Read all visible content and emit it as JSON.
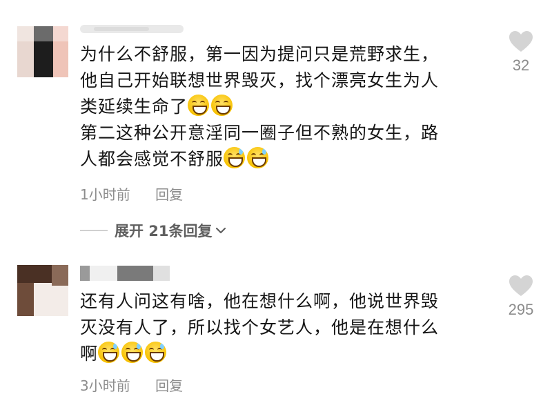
{
  "comments": [
    {
      "lines": [
        "为什么不舒服，第一因为提问只是荒野求生，",
        "他自己开始联想世界毁灭，找个漂亮女生为人",
        "类延续生命了",
        "第二这种公开意淫同一圈子但不熟的女生，路",
        "人都会感觉不舒服"
      ],
      "time": "1小时前",
      "reply_label": "回复",
      "likes": "32"
    },
    {
      "lines": [
        "还有人问这有啥，他在想什么啊，他说世界毁",
        "灭没有人了，所以找个女艺人，他是在想什么",
        "啊"
      ],
      "time": "3小时前",
      "reply_label": "回复",
      "likes": "295"
    }
  ],
  "expand_replies_label": "展开 21条回复",
  "emoji": [
    "grinning-face-emoji",
    "grinning-sweat-emoji"
  ]
}
